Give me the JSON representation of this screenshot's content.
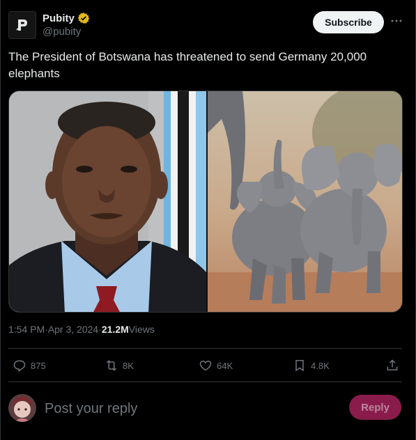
{
  "author": {
    "name": "Pubity",
    "handle": "@pubity",
    "avatar_letter": "P",
    "avatar_icon": "pubity-logo-icon",
    "verified_icon": "verified-gold-badge-icon"
  },
  "header": {
    "subscribe_label": "Subscribe",
    "more_icon": "ellipsis-icon"
  },
  "tweet": {
    "text": "The President of Botswana has threatened to send Germany 20,000 elephants",
    "media": {
      "left_image": "portrait-of-president-photo",
      "right_image": "two-baby-elephants-photo"
    }
  },
  "meta": {
    "time": "1:54 PM",
    "dot1": " · ",
    "date": "Apr 3, 2024",
    "dot2": " · ",
    "views_count": "21.2M",
    "views_label": " Views"
  },
  "actions": {
    "replies": "875",
    "reposts": "8K",
    "likes": "64K",
    "bookmarks": "4.8K",
    "reply_icon": "reply-icon",
    "repost_icon": "repost-icon",
    "like_icon": "heart-icon",
    "bookmark_icon": "bookmark-icon",
    "share_icon": "share-icon"
  },
  "reply": {
    "placeholder": "Post your reply",
    "button_label": "Reply"
  },
  "colors": {
    "background": "#000000",
    "text": "#e7e9ea",
    "muted": "#71767b",
    "reply_button": "#8a1c4b",
    "verified": "#e2b719"
  }
}
